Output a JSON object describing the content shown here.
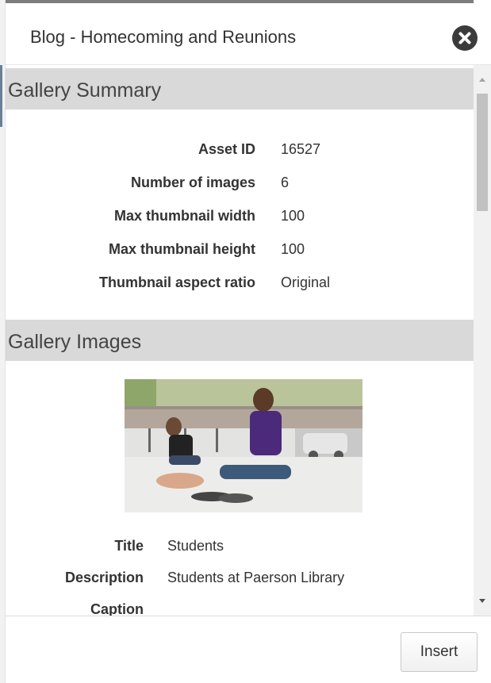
{
  "dialog": {
    "title": "Blog - Homecoming and Reunions",
    "close_icon": "close-circle-icon"
  },
  "gallery_summary": {
    "heading": "Gallery Summary",
    "rows": [
      {
        "label": "Asset ID",
        "value": "16527"
      },
      {
        "label": "Number of images",
        "value": "6"
      },
      {
        "label": "Max thumbnail width",
        "value": "100"
      },
      {
        "label": "Max thumbnail height",
        "value": "100"
      },
      {
        "label": "Thumbnail aspect ratio",
        "value": "Original"
      }
    ]
  },
  "gallery_images": {
    "heading": "Gallery Images",
    "image": {
      "rows": [
        {
          "label": "Title",
          "value": "Students"
        },
        {
          "label": "Description",
          "value": "Students at Paerson Library"
        },
        {
          "label": "Caption",
          "value": ""
        }
      ]
    }
  },
  "scrollbar": {
    "position_fraction": 0.0
  },
  "footer": {
    "insert_label": "Insert"
  }
}
